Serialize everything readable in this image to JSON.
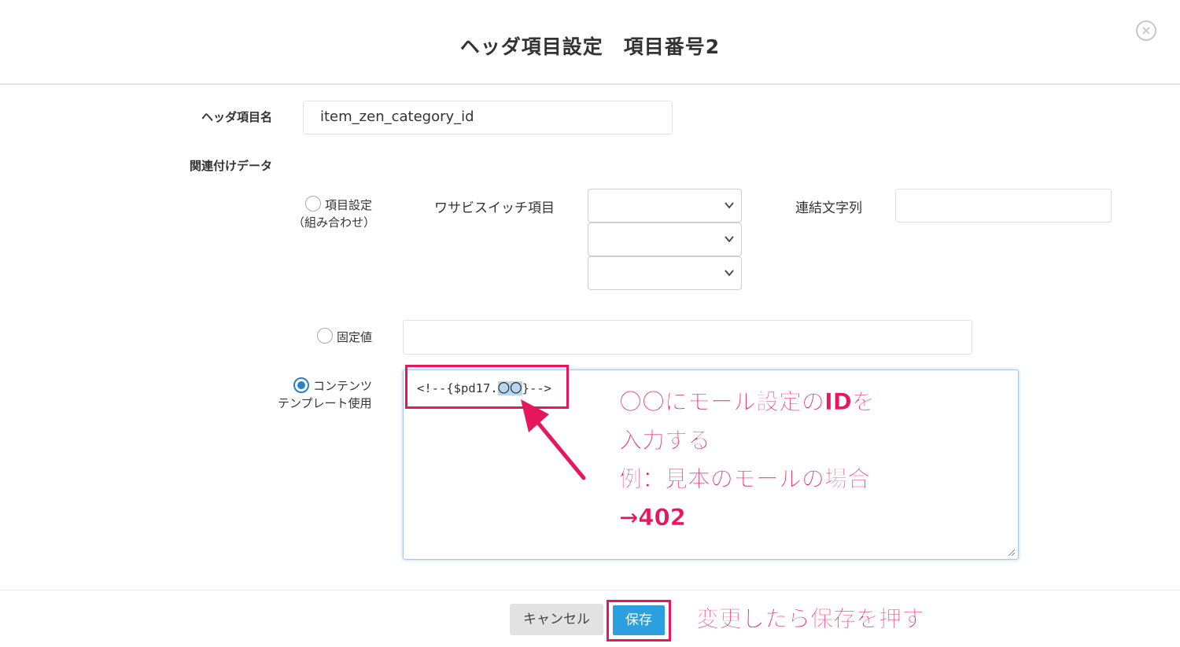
{
  "dialog": {
    "title": "ヘッダ項目設定　項目番号2",
    "close_icon": "close-circle-icon"
  },
  "form": {
    "header_name_label": "ヘッダ項目名",
    "header_name_value": "item_zen_category_id",
    "related_data_label": "関連付けデータ",
    "option_item_label_1": "項目設定",
    "option_item_label_2": "（組み合わせ）",
    "wasabi_item_label": "ワサビスイッチ項目",
    "join_string_label": "連結文字列",
    "join_string_value": "",
    "option_fixed_label": "固定値",
    "fixed_value": "",
    "option_template_label_1": "コンテンツ",
    "option_template_label_2": "テンプレート使用",
    "template_code_prefix": "<!--{$pd17.",
    "template_code_placeholder": "〇〇",
    "template_code_suffix": "}-->",
    "selected_option": "template"
  },
  "annotations": {
    "note_line1": "〇〇にモール設定のIDを",
    "note_line2": "入力する",
    "note_line3": "例：見本のモールの場合",
    "note_line4": "→402",
    "save_note": "変更したら保存を押す",
    "accent_color": "#e8175d"
  },
  "footer": {
    "cancel_label": "キャンセル",
    "save_label": "保存"
  }
}
